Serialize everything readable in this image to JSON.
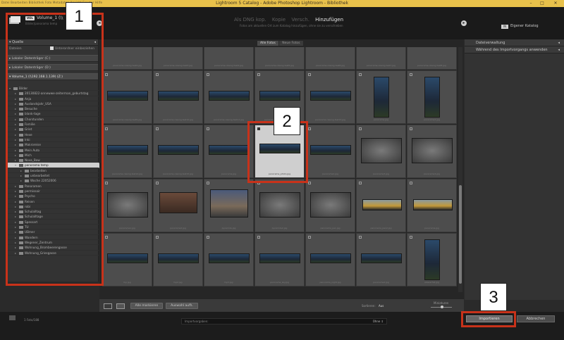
{
  "titlebar": {
    "title": "Lightroom 5 Catalog - Adobe Photoshop Lightroom - Bibliothek",
    "menu": "Datei  Bearbeiten  Bibliothek  Foto  Metadaten  Ansicht  Fenster  Hilfe",
    "min": "–",
    "max": "□",
    "close": "✕"
  },
  "header": {
    "volume_badge": "VOL",
    "volume_name": "Volume_1 (\\\\",
    "volume_sub": "Bilder/panorama temp",
    "modes": [
      "Als DNG kop.",
      "Kopie",
      "Versch.",
      "Hinzufügen"
    ],
    "modes_sub": "Fotos am aktuellen Ort zum Katalog hinzufügen, ohne sie zu verschieben",
    "dest_badge": "IN",
    "dest_name": "Eigener Katalog"
  },
  "source_panel": {
    "title": "Quelle",
    "collapse": "◂",
    "dateien_label": "Dateien",
    "subfolders_label": "Unterordner einbeziehen",
    "devices": [
      "Lokaler Datenträger (C:)",
      "Lokaler Datenträger (D:)",
      "Volume_1 (\\\\192.168.1.139) (Z:)"
    ],
    "root_folder": "Bilder",
    "folders": [
      "20130822-annewwe-zeiterman_geburtstag",
      "Anja",
      "Auslandsjahr_USA",
      "Besuche",
      "blank-tage",
      "Chorstunden",
      "Familie",
      "Griet",
      "Hexe",
      "Inki",
      "Makroreise",
      "Mein Auto",
      "Mich",
      "Nova_Bow",
      "panorama temp",
      "bearbeiten",
      "unbearbeitet",
      "Woche 22052006",
      "Panoramen",
      "permissoir",
      "Psycho",
      "Reisen",
      "robi",
      "Schulalltag",
      "Schulalltage",
      "Spessart",
      "TU",
      "UBmer",
      "Wandern",
      "Wegener_Zentrum",
      "Wohnung_Brombeerengasse",
      "Wohnung_Griesgasse"
    ]
  },
  "grid": {
    "tabs": [
      "Alle Fotos",
      "Neue Fotos"
    ],
    "filenames": [
      "panorama-rawing-test2.jpg",
      "panorama-rawing-test3.jpg",
      "panorama-rawing-test4.jpg",
      "panorama-rawing-test5.jpg",
      "panorama-rawing-test6.jpg",
      "panorama-rawing-test7.jpg",
      "panorama-rawing-test8.jpg",
      "panorama-rawing-test9.jpg",
      "panorama-rawing-test10.jpg",
      "panorama-rawing-test11.jpg",
      "panorama-rawing-test12.jpg",
      "panorama-rawing-test13.jpg",
      "panorama.jpg",
      "panorama2.jpg",
      "panorama-rawing-test14.jpg",
      "panorama-rawing-test15.jpg",
      "panorama.jpg",
      "panorama_photo.jpg",
      "panorama2.jpg",
      "panorama3.jpg",
      "panorama4.jpg",
      "panorama1.jpg",
      "panorama2.jpg",
      "pyramide.jpg",
      "pyramide2.jpg",
      "panorama_pan.jpg",
      "panorama_pan2.jpg",
      "panorama.jpg",
      "fuji.jpg",
      "fuji2.jpg",
      "fuji3.jpg",
      "panorama_sky.jpg",
      "panorama_night.jpg",
      "panorama2.jpg",
      "wasserfall.jpg"
    ]
  },
  "toolbar": {
    "check_all": "Alle markieren",
    "uncheck_all": "Auswahl aufh.",
    "sort_label": "Sortieren:",
    "sort_value": "Aus",
    "thumb_label": "Miniaturen"
  },
  "right_panel": {
    "section1": "Dateiverwaltung",
    "section2": "Während des Importvorgangs anwenden",
    "collapse": "◂"
  },
  "bottom": {
    "photos_count": "1 Foto/188",
    "preset_label": "Importvorgaben:",
    "preset_value": "Ohne ⇕",
    "import_button": "Importieren",
    "cancel_button": "Abbrechen"
  },
  "callouts": [
    "1",
    "2",
    "3"
  ],
  "colors": {
    "callout": "#c8321a",
    "titlebar": "#e8c14b",
    "selection": "#cfcfcf"
  }
}
